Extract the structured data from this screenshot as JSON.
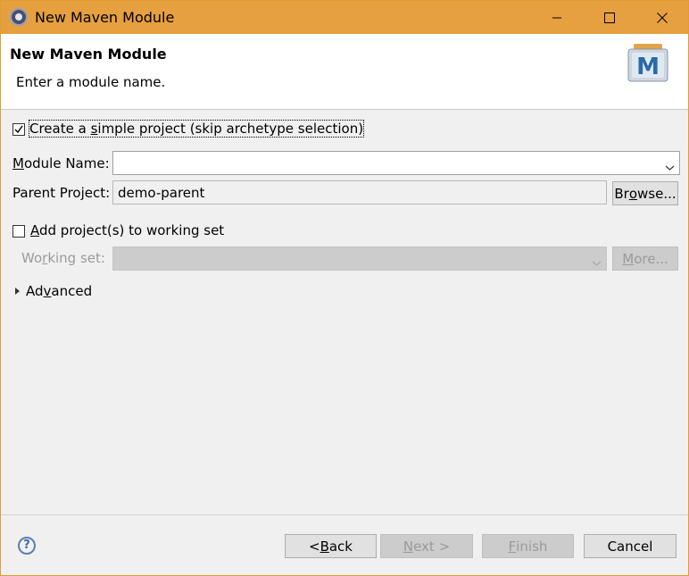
{
  "window": {
    "title": "New Maven Module",
    "controls": [
      "minimize-icon",
      "maximize-icon",
      "close-icon"
    ]
  },
  "header": {
    "title": "New Maven Module",
    "description": "Enter a module name.",
    "logo_icon": "maven-m-icon"
  },
  "form": {
    "simple_project": {
      "label_pre": "Create a ",
      "label_mnemonic": "s",
      "label_post": "imple project (skip archetype selection)",
      "checked": true
    },
    "module_name": {
      "label_mnemonic": "M",
      "label_post": "odule Name:",
      "value": ""
    },
    "parent_project": {
      "label": "Parent Project:",
      "value": "demo-parent",
      "browse_pre": "Br",
      "browse_mnemonic": "o",
      "browse_post": "wse..."
    },
    "working_set_toggle": {
      "label_mnemonic": "A",
      "label_post": "dd project(s) to working set",
      "checked": false
    },
    "working_set": {
      "label_pre": "Wo",
      "label_mnemonic": "r",
      "label_post": "king set:",
      "value": "",
      "more_mnemonic": "M",
      "more_post": "ore..."
    },
    "advanced": {
      "label_pre": "Ad",
      "label_mnemonic": "v",
      "label_post": "anced"
    }
  },
  "footer": {
    "help_icon": "help-icon",
    "help_glyph": "?",
    "back": {
      "pre": "< ",
      "mnemonic": "B",
      "post": "ack"
    },
    "next": {
      "mnemonic": "N",
      "post": "ext >"
    },
    "finish": {
      "mnemonic": "F",
      "post": "inish"
    },
    "cancel": "Cancel"
  },
  "colors": {
    "titlebar": "#e6a03f",
    "window_bg": "#f0f0f0",
    "disabled": "#cccccc"
  }
}
